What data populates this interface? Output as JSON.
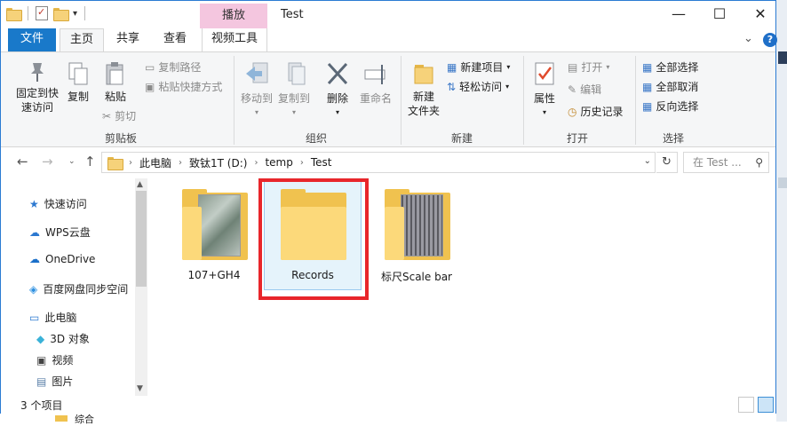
{
  "window": {
    "title": "Test",
    "contextual_tab": "播放",
    "controls": {
      "minimize": "—",
      "maximize": "☐",
      "close": "✕"
    }
  },
  "tabs": {
    "file": "文件",
    "home": "主页",
    "share": "共享",
    "view": "查看",
    "video_tools": "视频工具"
  },
  "ribbon": {
    "clipboard": {
      "label": "剪贴板",
      "pin": "固定到快\n速访问",
      "copy": "复制",
      "paste": "粘贴",
      "copy_path": "复制路径",
      "paste_shortcut": "粘贴快捷方式",
      "cut": "剪切"
    },
    "organize": {
      "label": "组织",
      "move_to": "移动到",
      "copy_to": "复制到",
      "delete": "删除",
      "rename": "重命名"
    },
    "new": {
      "label": "新建",
      "new_folder": "新建\n文件夹",
      "new_item": "新建项目",
      "easy_access": "轻松访问"
    },
    "open": {
      "label": "打开",
      "properties": "属性",
      "open": "打开",
      "edit": "编辑",
      "history": "历史记录"
    },
    "select": {
      "label": "选择",
      "select_all": "全部选择",
      "select_none": "全部取消",
      "invert": "反向选择"
    }
  },
  "address": {
    "crumbs": [
      "此电脑",
      "致钛1T (D:)",
      "temp",
      "Test"
    ],
    "search_placeholder": "在 Test ..."
  },
  "nav": {
    "items": [
      {
        "label": "快速访问",
        "icon": "star-icon"
      },
      {
        "label": "WPS云盘",
        "icon": "cloud-icon"
      },
      {
        "label": "OneDrive",
        "icon": "onedrive-icon"
      },
      {
        "label": "百度网盘同步空间",
        "icon": "baidu-icon"
      },
      {
        "label": "此电脑",
        "icon": "computer-icon"
      },
      {
        "label": "3D 对象",
        "icon": "cube-icon"
      },
      {
        "label": "视频",
        "icon": "video-icon"
      },
      {
        "label": "图片",
        "icon": "picture-icon"
      }
    ]
  },
  "files": [
    {
      "name": "107+GH4",
      "type": "folder-with-image-thumbnail"
    },
    {
      "name": "Records",
      "type": "folder",
      "selected": true
    },
    {
      "name": "标尺Scale bar",
      "type": "folder-with-image-thumbnail"
    }
  ],
  "status": {
    "count": "3 个项目"
  },
  "below_text": "综合"
}
